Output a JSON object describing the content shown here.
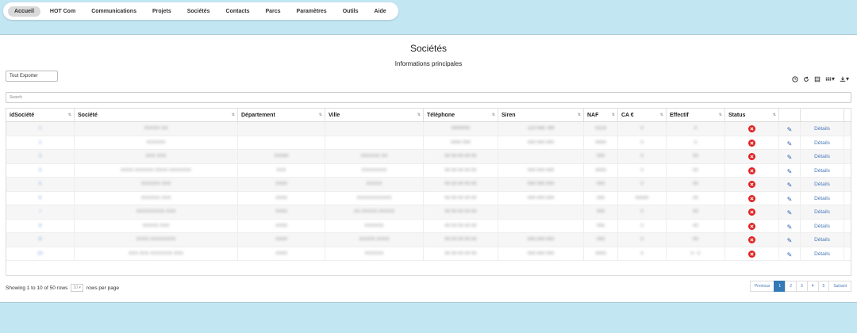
{
  "nav": [
    "Accueil",
    "HOT Com",
    "Communications",
    "Projets",
    "Sociétés",
    "Contacts",
    "Parcs",
    "Paramètres",
    "Outils",
    "Aide"
  ],
  "page": {
    "title": "Sociétés",
    "subtitle": "Informations principales"
  },
  "export_label": "Tout Exporter",
  "search_placeholder": "Search",
  "columns": [
    "idSociété",
    "Société",
    "Département",
    "Ville",
    "Téléphone",
    "Siren",
    "NAF",
    "CA €",
    "Effectif",
    "Status",
    "",
    ""
  ],
  "rows": [
    [
      "1",
      "XXXXX SA",
      "",
      "",
      "0000000",
      "123 456 789",
      "0123",
      "0",
      "0",
      "",
      "",
      "Détails"
    ],
    [
      "2",
      "XXXXXX",
      "",
      "",
      "0000 000",
      "000 000 000",
      "0000",
      "0",
      "0",
      "",
      "",
      "Détails"
    ],
    [
      "3",
      "XXX XXX",
      "XX000",
      "XXXXXX XX",
      "00 00 00 00 00",
      "",
      "000",
      "0",
      "00",
      "",
      "",
      "Détails"
    ],
    [
      "4",
      "XXXX XXXXXX XXXX XXXXXXX",
      "XXX",
      "XXXXXXXX",
      "00 00 00 00 00",
      "000 000 000",
      "0000",
      "0",
      "00",
      "",
      "",
      "Détails"
    ],
    [
      "5",
      "XXXXXX XXX",
      "XX00",
      "XXXXX",
      "00 00 00 00 00",
      "000 000 000",
      "000",
      "0",
      "00",
      "",
      "",
      "Détails"
    ],
    [
      "6",
      "XXXXXX XXX",
      "XX00",
      "XXXXXXXXXXX",
      "00 00 00 00 00",
      "000 000 000",
      "000",
      "00000",
      "00",
      "",
      "",
      "Détails"
    ],
    [
      "7",
      "XXXXXXXXX XXX",
      "XX00",
      "XX XXXXX XXXXX",
      "00 00 00 00 00",
      "",
      "000",
      "0",
      "00",
      "",
      "",
      "Détails"
    ],
    [
      "8",
      "XXXXX XXX",
      "XX00",
      "XXXXXX",
      "00 00 00 00 00",
      "",
      "000",
      "0",
      "00",
      "",
      "",
      "Détails"
    ],
    [
      "9",
      "XXXX XXXXXXXX",
      "XX00",
      "XXXXX XXXX",
      "00 00 00 00 00",
      "000 000 000",
      "000",
      "0",
      "00",
      "",
      "",
      "Détails"
    ],
    [
      "10",
      "XXX XXX XXXXXXX XXX",
      "XX00",
      "XXXXXX",
      "00 00 00 00 00",
      "000 000 000",
      "0000",
      "0",
      "0 - 0",
      "",
      "",
      "Détails"
    ]
  ],
  "footer": {
    "showing": "Showing 1 to 10 of 50 rows",
    "per_page_value": "10",
    "per_page_suffix": "rows per page"
  },
  "pager": [
    "Previous",
    "1",
    "2",
    "3",
    "4",
    "5",
    "Suivant"
  ],
  "colors": {
    "accent": "#337ab7",
    "status": "#e02020",
    "background": "#c3e6f3"
  }
}
